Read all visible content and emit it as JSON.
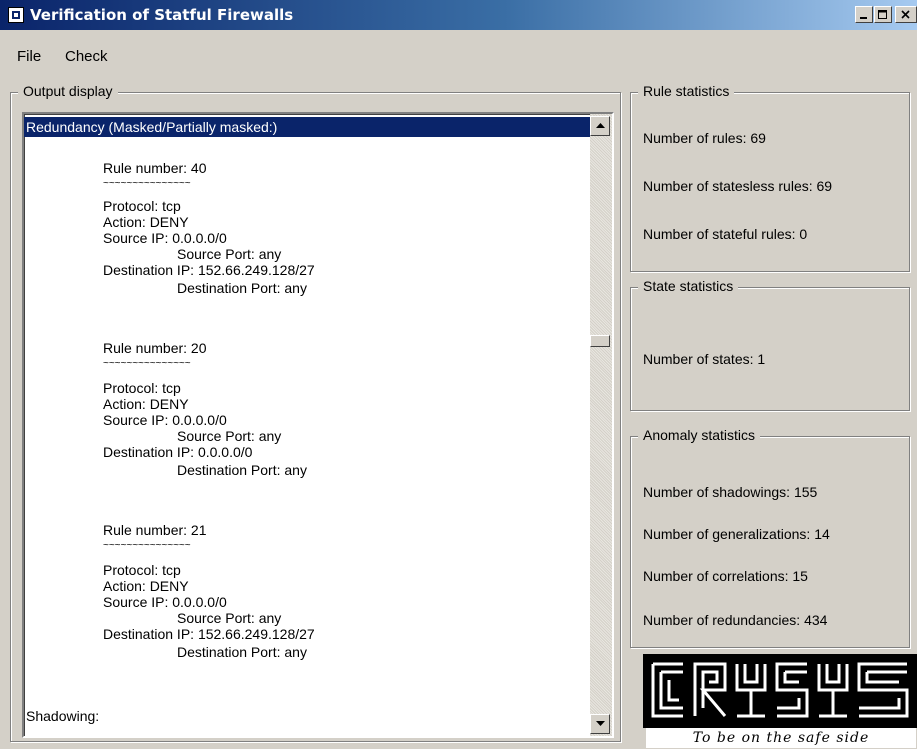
{
  "window": {
    "title": "Verification of Statful Firewalls",
    "controls": [
      "minimize",
      "maximize",
      "close"
    ]
  },
  "menu": {
    "file": "File",
    "check": "Check"
  },
  "output": {
    "group_title": "Output display",
    "header": "Redundancy (Masked/Partially masked:)",
    "tilde": "~~~~~~~~~~~~~~~",
    "rules": [
      {
        "number": "Rule number: 40",
        "protocol": "Protocol: tcp",
        "action": "Action: DENY",
        "src_ip": "Source IP: 0.0.0.0/0",
        "src_port": "Source Port: any",
        "dst_ip": "Destination IP: 152.66.249.128/27",
        "dst_port": "Destination Port: any"
      },
      {
        "number": "Rule number: 20",
        "protocol": "Protocol: tcp",
        "action": "Action: DENY",
        "src_ip": "Source IP: 0.0.0.0/0",
        "src_port": "Source Port: any",
        "dst_ip": "Destination IP: 0.0.0.0/0",
        "dst_port": "Destination Port: any"
      },
      {
        "number": "Rule number: 21",
        "protocol": "Protocol: tcp",
        "action": "Action: DENY",
        "src_ip": "Source IP: 0.0.0.0/0",
        "src_port": "Source Port: any",
        "dst_ip": "Destination IP: 152.66.249.128/27",
        "dst_port": "Destination Port: any"
      }
    ],
    "footer": "Shadowing:"
  },
  "rule_stats": {
    "title": "Rule statistics",
    "rules": "Number of rules: 69",
    "stateless": "Number of statesless rules: 69",
    "stateful": "Number of stateful rules: 0"
  },
  "state_stats": {
    "title": "State statistics",
    "states": "Number of states: 1"
  },
  "anomaly_stats": {
    "title": "Anomaly statistics",
    "shadowings": "Number of shadowings: 155",
    "generalizations": "Number of generalizations: 14",
    "correlations": "Number of correlations: 15",
    "redundancies": "Number of redundancies: 434"
  },
  "logo": {
    "text": "CRYSYS",
    "slogan": "To be on the safe side"
  },
  "colors": {
    "titlebar_start": "#0a246a",
    "titlebar_end": "#a6caf0",
    "window_bg": "#d4d0c8",
    "selection": "#0a246a"
  }
}
